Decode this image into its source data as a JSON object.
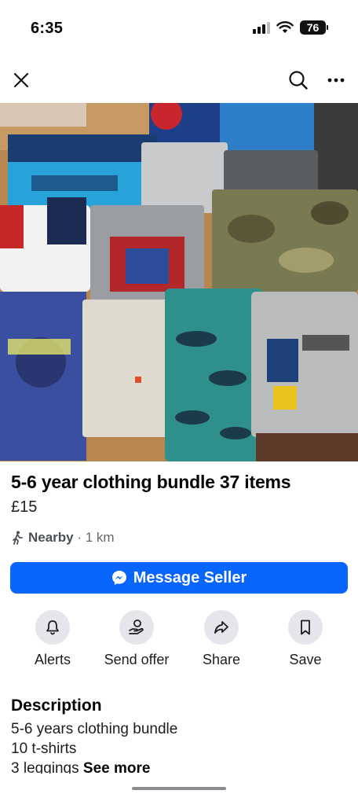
{
  "status_bar": {
    "time": "6:35",
    "battery": "76"
  },
  "nav": {
    "close_icon": "close-icon",
    "search_icon": "search-icon",
    "more_icon": "more-horizontal-icon"
  },
  "listing": {
    "title": "5-6 year clothing bundle 37 items",
    "price": "£15",
    "location_label": "Nearby",
    "location_distance": " · 1 km"
  },
  "message_button": {
    "label": "Message Seller",
    "color": "#0866ff"
  },
  "actions": [
    {
      "label": "Alerts",
      "icon": "bell-icon"
    },
    {
      "label": "Send offer",
      "icon": "offer-hand-icon"
    },
    {
      "label": "Share",
      "icon": "share-arrow-icon"
    },
    {
      "label": "Save",
      "icon": "bookmark-icon"
    }
  ],
  "description": {
    "heading": "Description",
    "lines": [
      "5-6 years clothing bundle",
      "10 t-shirts",
      "3 leggings"
    ],
    "see_more": "See more"
  }
}
